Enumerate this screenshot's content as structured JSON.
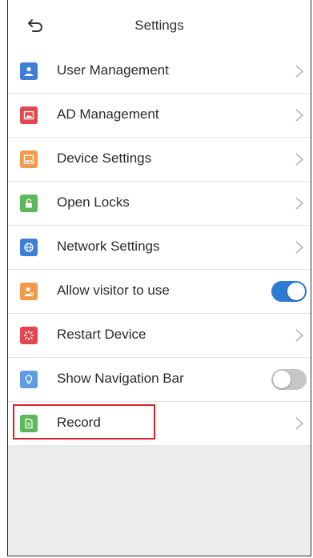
{
  "header": {
    "title": "Settings",
    "back_icon": "back-arrow-icon"
  },
  "items": [
    {
      "label": "User Management",
      "icon": "user-icon",
      "color": "#3d7fd6",
      "control": "chevron"
    },
    {
      "label": "AD Management",
      "icon": "ad-image-icon",
      "color": "#e2464f",
      "control": "chevron"
    },
    {
      "label": "Device Settings",
      "icon": "device-icon",
      "color": "#f09a4a",
      "control": "chevron"
    },
    {
      "label": "Open Locks",
      "icon": "lock-icon",
      "color": "#5bb85b",
      "control": "chevron"
    },
    {
      "label": "Network Settings",
      "icon": "globe-icon",
      "color": "#3d7fd6",
      "control": "chevron"
    },
    {
      "label": "Allow visitor to use",
      "icon": "visitor-icon",
      "color": "#f09a4a",
      "control": "toggle",
      "toggle_on": true
    },
    {
      "label": "Restart Device",
      "icon": "restart-icon",
      "color": "#e2464f",
      "control": "chevron"
    },
    {
      "label": "Show Navigation Bar",
      "icon": "bulb-icon",
      "color": "#5f9be0",
      "control": "toggle",
      "toggle_on": false
    },
    {
      "label": "Record",
      "icon": "record-icon",
      "color": "#5bb85b",
      "control": "chevron",
      "highlighted": true
    }
  ],
  "colors": {
    "accent": "#2e7bd3",
    "highlight_border": "#d5242d",
    "background": "#ececec"
  }
}
